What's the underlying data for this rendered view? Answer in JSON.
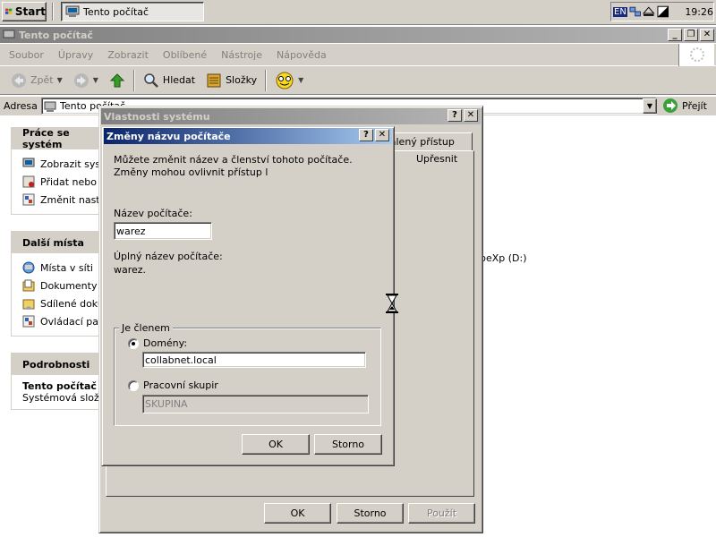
{
  "taskbar": {
    "start_label": "Start",
    "task_title": "Tento počítač",
    "language": "EN",
    "clock": "19:26"
  },
  "explorer": {
    "title": "Tento počítač",
    "menu": [
      "Soubor",
      "Úpravy",
      "Zobrazit",
      "Oblíbené",
      "Nástroje",
      "Nápověda"
    ],
    "toolbar": {
      "back_label": "Zpět",
      "search_label": "Hledat",
      "folders_label": "Složky"
    },
    "address": {
      "label": "Adresa",
      "value": "Tento počítač",
      "go_label": "Přejít"
    },
    "panels": {
      "system_tasks": {
        "title": "Práce se systém",
        "items": [
          "Zobrazit syst",
          "Přidat nebo c",
          "Změnit nasta"
        ]
      },
      "other_places": {
        "title": "Další místa",
        "items": [
          "Místa v síti",
          "Dokumenty",
          "Sdílené dokur",
          "Ovládací pan"
        ]
      },
      "details": {
        "title": "Podrobnosti",
        "name": "Tento počítač",
        "desc": "Systémová složka"
      }
    },
    "drive_label": "beXp (D:)"
  },
  "sys_dialog": {
    "title": "Vlastnosti systému",
    "tab_remote": "zdálený přístup",
    "tab_advanced": "Upřesnit",
    "ok": "OK",
    "cancel": "Storno",
    "apply": "Použít"
  },
  "rename_dialog": {
    "title": "Změny názvu počítače",
    "description": "Můžete změnit název a členství tohoto počítače. Změny mohou ovlivnit přístup l",
    "name_label": "Název počítače:",
    "name_value": "warez",
    "full_name_label": "Úplný název počítače:",
    "full_name_value": "warez.",
    "member_legend": "Je členem",
    "domain_label": "Domény:",
    "domain_value": "collabnet.local",
    "workgroup_label": "Pracovní skupir",
    "workgroup_value": "SKUPINA",
    "ok": "OK",
    "cancel": "Storno"
  }
}
